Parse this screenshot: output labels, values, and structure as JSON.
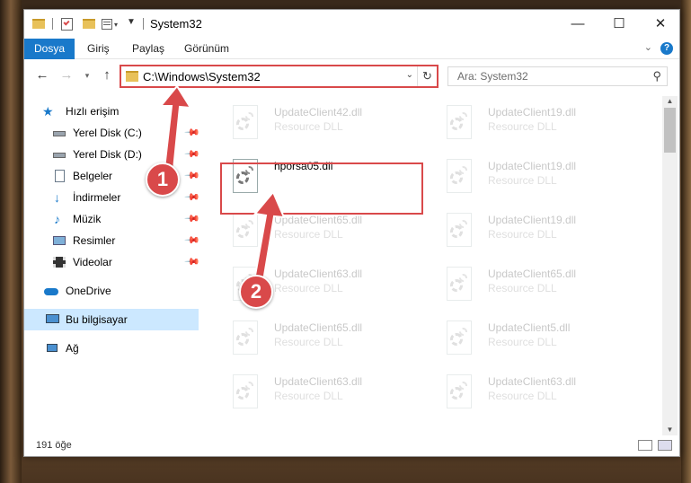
{
  "window": {
    "title": "System32",
    "controls": {
      "minimize": "—",
      "maximize": "☐",
      "close": "✕"
    }
  },
  "ribbon": {
    "tabs": [
      {
        "label": "Dosya",
        "active": true
      },
      {
        "label": "Giriş"
      },
      {
        "label": "Paylaş"
      },
      {
        "label": "Görünüm"
      }
    ],
    "help": "?"
  },
  "nav": {
    "address": "C:\\Windows\\System32",
    "search_placeholder": "Ara: System32"
  },
  "sidebar": {
    "items": [
      {
        "label": "Hızlı erişim",
        "icon": "star-icon",
        "pinned": false
      },
      {
        "label": "Yerel Disk (C:)",
        "icon": "drive-icon",
        "pinned": true
      },
      {
        "label": "Yerel Disk (D:)",
        "icon": "drive-icon",
        "pinned": true
      },
      {
        "label": "Belgeler",
        "icon": "documents-icon",
        "pinned": true
      },
      {
        "label": "İndirmeler",
        "icon": "downloads-icon",
        "pinned": true
      },
      {
        "label": "Müzik",
        "icon": "music-icon",
        "pinned": true
      },
      {
        "label": "Resimler",
        "icon": "pictures-icon",
        "pinned": true
      },
      {
        "label": "Videolar",
        "icon": "videos-icon",
        "pinned": true
      },
      {
        "label": "OneDrive",
        "icon": "cloud-icon",
        "pinned": false
      },
      {
        "label": "Bu bilgisayar",
        "icon": "computer-icon",
        "pinned": false,
        "selected": true
      },
      {
        "label": "Ağ",
        "icon": "network-icon",
        "pinned": false
      }
    ]
  },
  "files": [
    {
      "name": "UpdateClient42.dll",
      "type": "Resource DLL",
      "faded": true
    },
    {
      "name": "UpdateClient19.dll",
      "type": "Resource DLL",
      "faded": true
    },
    {
      "name": "hporsa05.dll",
      "type": "",
      "faded": false
    },
    {
      "name": "UpdateClient19.dll",
      "type": "Resource DLL",
      "faded": true
    },
    {
      "name": "UpdateClient65.dll",
      "type": "Resource DLL",
      "faded": true
    },
    {
      "name": "UpdateClient19.dll",
      "type": "Resource DLL",
      "faded": true
    },
    {
      "name": "UpdateClient63.dll",
      "type": "Resource DLL",
      "faded": true
    },
    {
      "name": "UpdateClient65.dll",
      "type": "Resource DLL",
      "faded": true
    },
    {
      "name": "UpdateClient65.dll",
      "type": "Resource DLL",
      "faded": true
    },
    {
      "name": "UpdateClient5.dll",
      "type": "Resource DLL",
      "faded": true
    },
    {
      "name": "UpdateClient63.dll",
      "type": "Resource DLL",
      "faded": true
    },
    {
      "name": "UpdateClient63.dll",
      "type": "Resource DLL",
      "faded": true
    }
  ],
  "status": {
    "count": "191 öğe"
  },
  "annotations": {
    "step1": "1",
    "step2": "2",
    "color": "#d9494a"
  }
}
